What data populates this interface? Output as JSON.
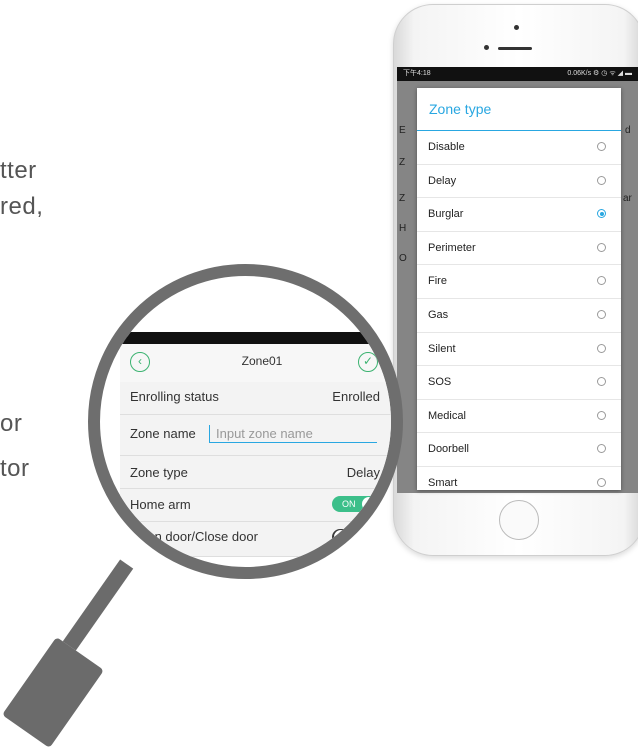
{
  "left_text": {
    "frag1": "tter",
    "frag2": "red,",
    "frag3": "or",
    "frag4": "tor"
  },
  "phone": {
    "status_left": "下午4:18",
    "status_right": "0.06K/s ⚙ ◷ ᯤ ◢ ▬",
    "background_fragments": [
      "E",
      "d",
      "Z",
      "Z",
      "ar",
      "H",
      "O"
    ],
    "dialog": {
      "title": "Zone type",
      "options": [
        {
          "label": "Disable",
          "selected": false
        },
        {
          "label": "Delay",
          "selected": false
        },
        {
          "label": "Burglar",
          "selected": true
        },
        {
          "label": "Perimeter",
          "selected": false
        },
        {
          "label": "Fire",
          "selected": false
        },
        {
          "label": "Gas",
          "selected": false
        },
        {
          "label": "Silent",
          "selected": false
        },
        {
          "label": "SOS",
          "selected": false
        },
        {
          "label": "Medical",
          "selected": false
        },
        {
          "label": "Doorbell",
          "selected": false
        },
        {
          "label": "Smart",
          "selected": false
        }
      ]
    }
  },
  "zoom": {
    "title": "Zone01",
    "back_icon": "chevron-left-icon",
    "confirm_icon": "check-icon",
    "rows": {
      "enrolling_label": "Enrolling status",
      "enrolling_value": "Enrolled",
      "zone_name_label": "Zone name",
      "zone_name_placeholder": "Input zone name",
      "zone_type_label": "Zone type",
      "zone_type_value": "Delay",
      "home_arm_label": "Home arm",
      "home_arm_state": "ON",
      "door_label": "Open door/Close door",
      "door_state": "OFF"
    }
  },
  "colors": {
    "accent_blue": "#29a7e1",
    "accent_green": "#3cbf8a",
    "magnifier_gray": "#6e6e6e"
  }
}
